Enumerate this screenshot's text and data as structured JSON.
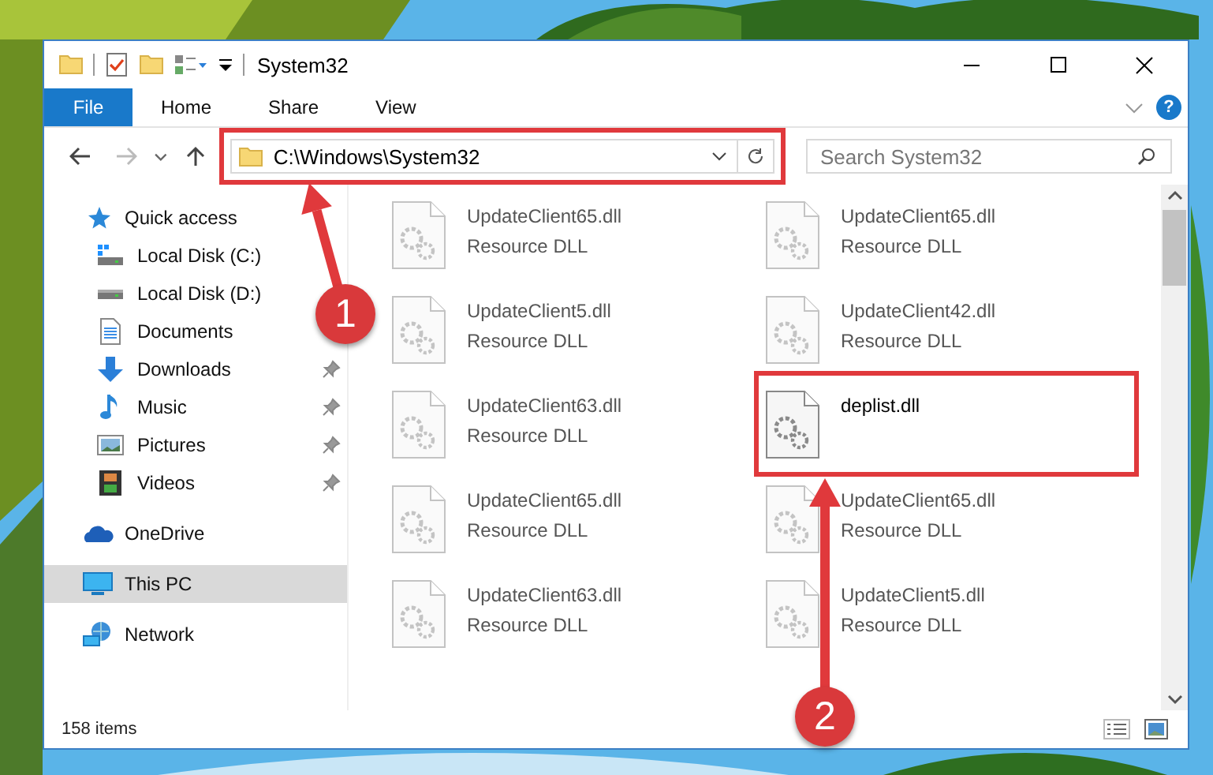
{
  "window": {
    "title": "System32"
  },
  "ribbon": {
    "tabs": [
      {
        "label": "File",
        "kind": "file"
      },
      {
        "label": "Home",
        "kind": "tab"
      },
      {
        "label": "Share",
        "kind": "tab"
      },
      {
        "label": "View",
        "kind": "tab"
      }
    ],
    "help": "?"
  },
  "navigation": {
    "back_enabled": true,
    "forward_enabled": false
  },
  "address": {
    "value": "C:\\Windows\\System32"
  },
  "search": {
    "placeholder": "Search System32"
  },
  "sidebar": {
    "items": [
      {
        "label": "Quick access",
        "kind": "star",
        "selected": false,
        "children": [
          {
            "label": "Local Disk (C:)",
            "kind": "windrive",
            "pinned": false
          },
          {
            "label": "Local Disk (D:)",
            "kind": "drive",
            "pinned": false
          },
          {
            "label": "Documents",
            "kind": "documents",
            "pinned": false
          },
          {
            "label": "Downloads",
            "kind": "downloads",
            "pinned": true
          },
          {
            "label": "Music",
            "kind": "music",
            "pinned": true
          },
          {
            "label": "Pictures",
            "kind": "pictures",
            "pinned": true
          },
          {
            "label": "Videos",
            "kind": "videos",
            "pinned": true
          }
        ]
      },
      {
        "label": "OneDrive",
        "kind": "cloud",
        "selected": false
      },
      {
        "label": "This PC",
        "kind": "pc",
        "selected": true
      },
      {
        "label": "Network",
        "kind": "network",
        "selected": false
      }
    ]
  },
  "files": [
    {
      "name": "UpdateClient65.dll",
      "type": "Resource DLL",
      "blurred": true
    },
    {
      "name": "UpdateClient65.dll",
      "type": "Resource DLL",
      "blurred": true
    },
    {
      "name": "UpdateClient5.dll",
      "type": "Resource DLL",
      "blurred": true
    },
    {
      "name": "UpdateClient42.dll",
      "type": "Resource DLL",
      "blurred": true
    },
    {
      "name": "UpdateClient63.dll",
      "type": "Resource DLL",
      "blurred": true
    },
    {
      "name": "deplist.dll",
      "blurred": false
    },
    {
      "name": "UpdateClient65.dll",
      "type": "Resource DLL",
      "blurred": true
    },
    {
      "name": "UpdateClient65.dll",
      "type": "Resource DLL",
      "blurred": true
    },
    {
      "name": "UpdateClient63.dll",
      "type": "Resource DLL",
      "blurred": true
    },
    {
      "name": "UpdateClient5.dll",
      "type": "Resource DLL",
      "blurred": true
    }
  ],
  "status_bar": {
    "text": "158 items"
  },
  "callouts": [
    {
      "number": "1"
    },
    {
      "number": "2"
    }
  ]
}
